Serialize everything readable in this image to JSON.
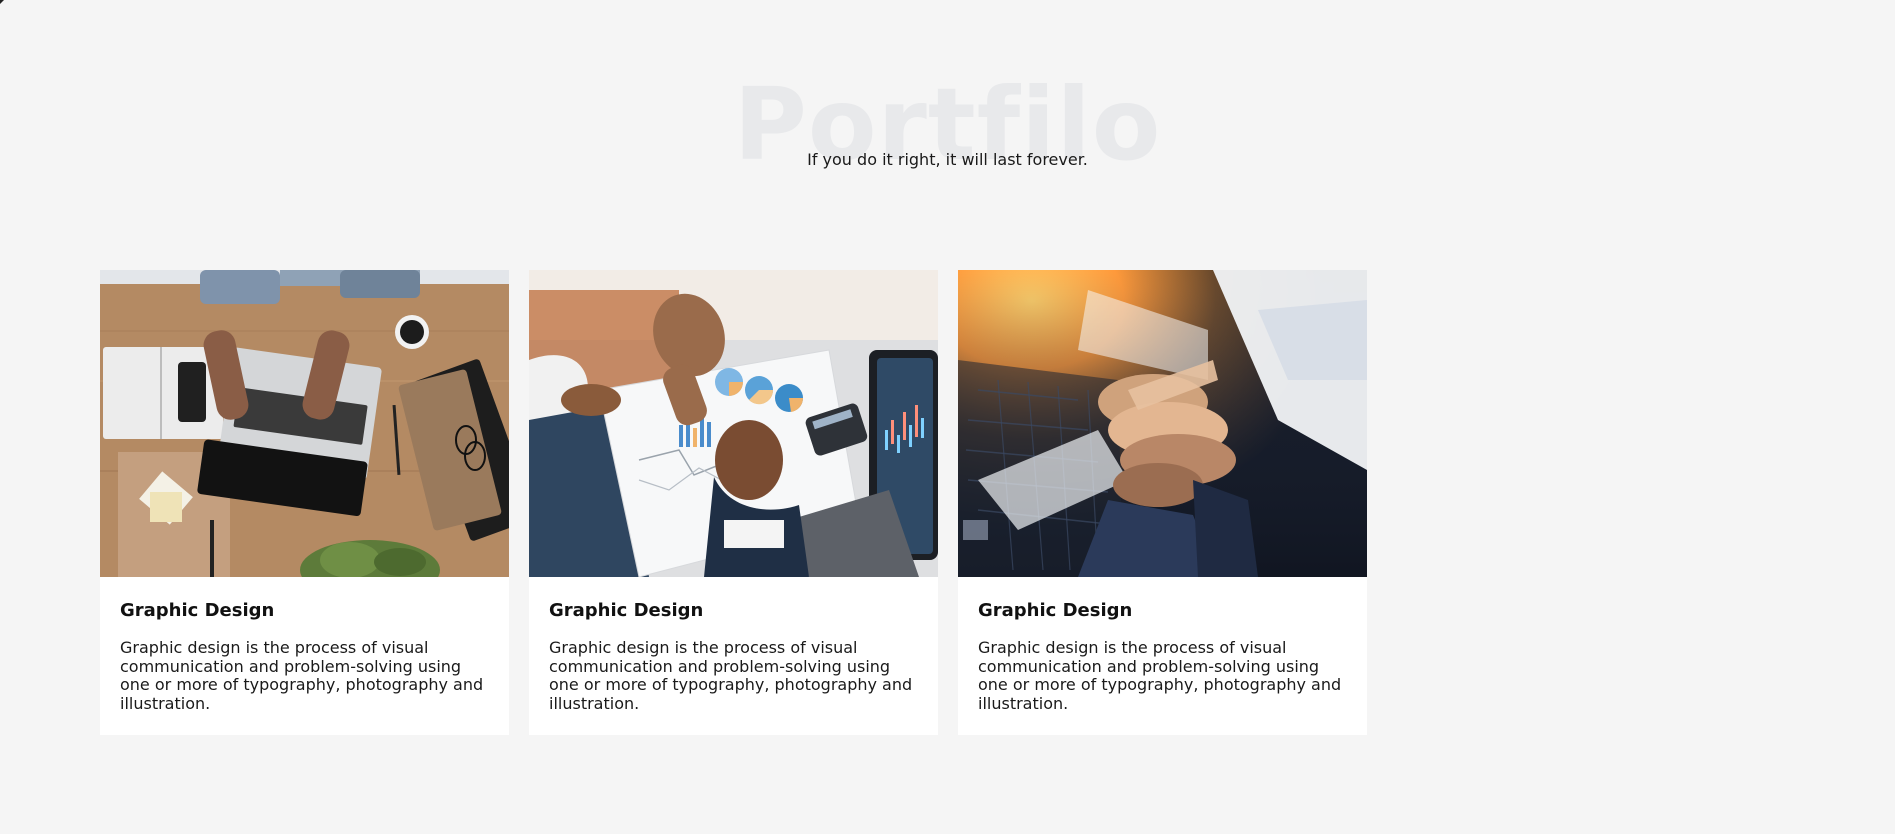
{
  "hero": {
    "watermark": "Portfilo",
    "subtitle": "If you do it right, it will last forever."
  },
  "cards": [
    {
      "image_name": "workspace-laptop-image",
      "title": "Graphic Design",
      "text": "Graphic design is the process of visual communication and problem-solving using one or more of typography, photography and illustration."
    },
    {
      "image_name": "charts-meeting-image",
      "title": "Graphic Design",
      "text": "Graphic design is the process of visual communication and problem-solving using one or more of typography, photography and illustration."
    },
    {
      "image_name": "team-hands-image",
      "title": "Graphic Design",
      "text": "Graphic design is the process of visual communication and problem-solving using one or more of typography, photography and illustration."
    }
  ]
}
